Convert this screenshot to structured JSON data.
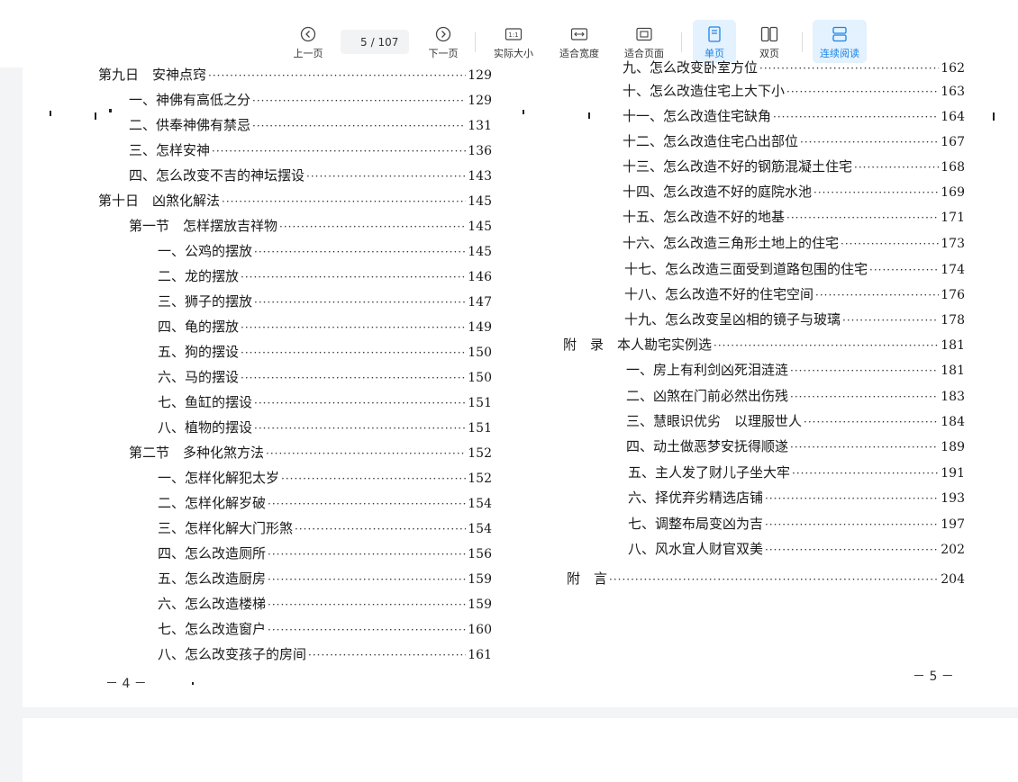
{
  "toolbar": {
    "prev_label": "上一页",
    "current_page": "5",
    "total_pages": "/ 107",
    "next_label": "下一页",
    "actual_size_label": "实际大小",
    "fit_width_label": "适合宽度",
    "fit_page_label": "适合页面",
    "single_page_label": "单页",
    "double_page_label": "双页",
    "continuous_label": "连续阅读",
    "accent_color": "#1a85e6"
  },
  "left_page": {
    "entries": [
      {
        "title": "第九日　安神点窍",
        "page": "129"
      },
      {
        "title": "一、神佛有高低之分",
        "page": "129"
      },
      {
        "title": "二、供奉神佛有禁忌",
        "page": "131"
      },
      {
        "title": "三、怎样安神",
        "page": "136"
      },
      {
        "title": "四、怎么改变不吉的神坛摆设",
        "page": "143"
      },
      {
        "title": "第十日　凶煞化解法",
        "page": "145"
      },
      {
        "title": "第一节　怎样摆放吉祥物",
        "page": "145"
      },
      {
        "title": "一、公鸡的摆放",
        "page": "145"
      },
      {
        "title": "二、龙的摆放",
        "page": "146"
      },
      {
        "title": "三、狮子的摆放",
        "page": "147"
      },
      {
        "title": "四、龟的摆放",
        "page": "149"
      },
      {
        "title": "五、狗的摆设",
        "page": "150"
      },
      {
        "title": "六、马的摆设",
        "page": "150"
      },
      {
        "title": "七、鱼缸的摆设",
        "page": "151"
      },
      {
        "title": "八、植物的摆设",
        "page": "151"
      },
      {
        "title": "第二节　多种化煞方法",
        "page": "152"
      },
      {
        "title": "一、怎样化解犯太岁",
        "page": "152"
      },
      {
        "title": "二、怎样化解岁破",
        "page": "154"
      },
      {
        "title": "三、怎样化解大门形煞",
        "page": "154"
      },
      {
        "title": "四、怎么改造厕所",
        "page": "156"
      },
      {
        "title": "五、怎么改造厨房",
        "page": "159"
      },
      {
        "title": "六、怎么改造楼梯",
        "page": "159"
      },
      {
        "title": "七、怎么改造窗户",
        "page": "160"
      },
      {
        "title": "八、怎么改变孩子的房间",
        "page": "161"
      }
    ],
    "folio": "－ 4 －"
  },
  "right_page": {
    "entries": [
      {
        "title": "九、怎么改变卧室方位",
        "page": "162"
      },
      {
        "title": "十、怎么改造住宅上大下小",
        "page": "163"
      },
      {
        "title": "十一、怎么改造住宅缺角",
        "page": "164"
      },
      {
        "title": "十二、怎么改造住宅凸出部位",
        "page": "167"
      },
      {
        "title": "十三、怎么改造不好的钢筋混凝土住宅",
        "page": "168"
      },
      {
        "title": "十四、怎么改造不好的庭院水池",
        "page": "169"
      },
      {
        "title": "十五、怎么改造不好的地基",
        "page": "171"
      },
      {
        "title": "十六、怎么改造三角形土地上的住宅",
        "page": "173"
      },
      {
        "title": "十七、怎么改造三面受到道路包围的住宅",
        "page": "174"
      },
      {
        "title": "十八、怎么改造不好的住宅空间",
        "page": "176"
      },
      {
        "title": "十九、怎么改变呈凶相的镜子与玻璃",
        "page": "178"
      },
      {
        "title": "附　录　本人勘宅实例选",
        "page": "181"
      },
      {
        "title": "一、房上有利剑凶死泪涟涟",
        "page": "181"
      },
      {
        "title": "二、凶煞在门前必然出伤残",
        "page": "183"
      },
      {
        "title": "三、慧眼识优劣　以理服世人",
        "page": "184"
      },
      {
        "title": "四、动土做恶梦安抚得顺遂",
        "page": "189"
      },
      {
        "title": "五、主人发了财儿子坐大牢",
        "page": "191"
      },
      {
        "title": "六、择优弃劣精选店铺",
        "page": "193"
      },
      {
        "title": "七、调整布局变凶为吉",
        "page": "197"
      },
      {
        "title": "八、风水宜人财官双美",
        "page": "202"
      },
      {
        "title": "附　言",
        "page": "204"
      }
    ],
    "folio": "－ 5 －"
  }
}
